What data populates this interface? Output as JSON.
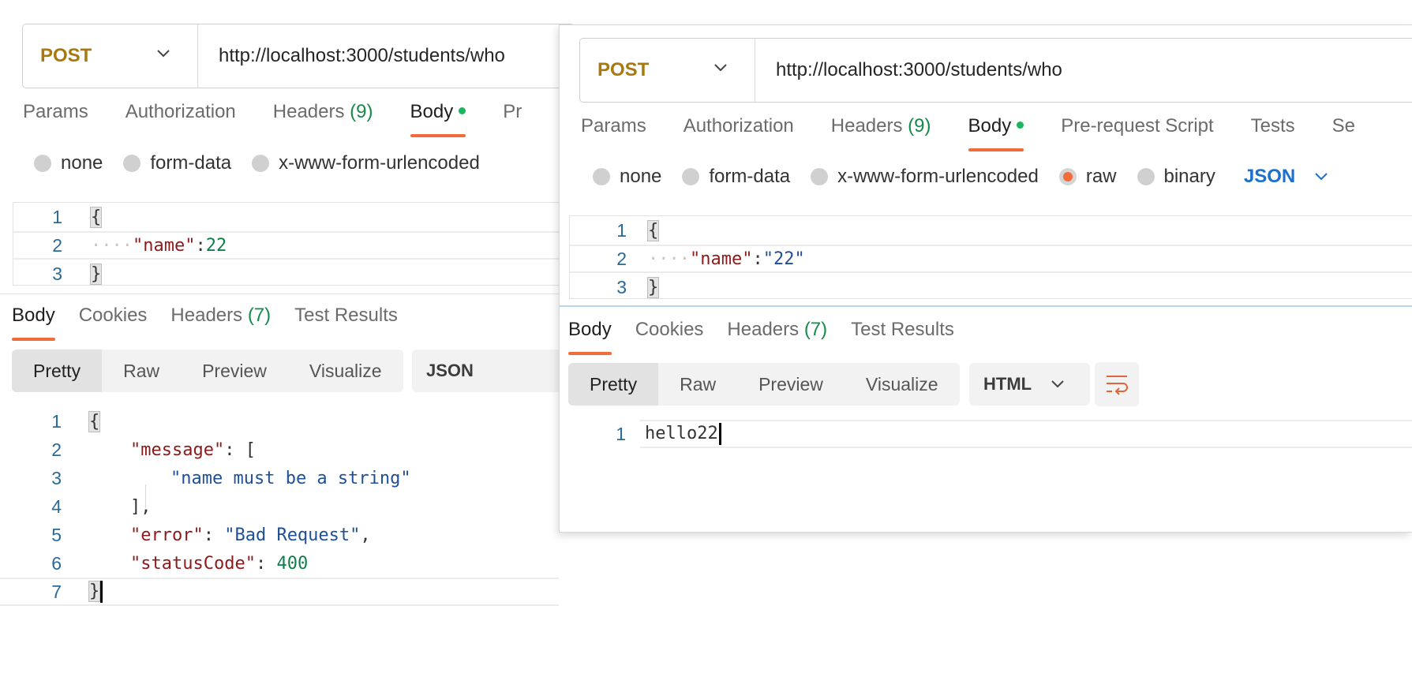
{
  "back": {
    "request": {
      "method": "POST",
      "url": "http://localhost:3000/students/who"
    },
    "tabs": [
      {
        "label": "Params"
      },
      {
        "label": "Authorization"
      },
      {
        "label": "Headers",
        "count": "(9)"
      },
      {
        "label": "Body"
      },
      {
        "label": "Pr"
      }
    ],
    "body_types": [
      "none",
      "form-data",
      "x-www-form-urlencoded"
    ],
    "request_body": {
      "lines": [
        "1",
        "2",
        "3"
      ],
      "open": "{",
      "ws": "····",
      "key": "\"name\"",
      "colon": ":",
      "value": "22",
      "close": "}"
    },
    "response_tabs": [
      {
        "label": "Body"
      },
      {
        "label": "Cookies"
      },
      {
        "label": "Headers",
        "count": "(7)"
      },
      {
        "label": "Test Results"
      }
    ],
    "view_modes": [
      "Pretty",
      "Raw",
      "Preview",
      "Visualize"
    ],
    "format": "JSON",
    "response": {
      "lines": [
        "1",
        "2",
        "3",
        "4",
        "5",
        "6",
        "7"
      ],
      "open": "{",
      "message_key": "\"message\"",
      "message_open": ": [",
      "message_item": "\"name must be a string\"",
      "message_close": "],",
      "error_key": "\"error\"",
      "error_sep": ": ",
      "error_value": "\"Bad Request\"",
      "error_comma": ",",
      "status_key": "\"statusCode\"",
      "status_sep": ": ",
      "status_value": "400",
      "close": "}"
    }
  },
  "front": {
    "request": {
      "method": "POST",
      "url": "http://localhost:3000/students/who"
    },
    "tabs": [
      {
        "label": "Params"
      },
      {
        "label": "Authorization"
      },
      {
        "label": "Headers",
        "count": "(9)"
      },
      {
        "label": "Body"
      },
      {
        "label": "Pre-request Script"
      },
      {
        "label": "Tests"
      },
      {
        "label": "Se"
      }
    ],
    "body_types": [
      "none",
      "form-data",
      "x-www-form-urlencoded",
      "raw",
      "binary"
    ],
    "selected_body_type": "raw",
    "body_language": "JSON",
    "request_body": {
      "lines": [
        "1",
        "2",
        "3"
      ],
      "open": "{",
      "ws": "····",
      "key": "\"name\"",
      "colon": ":",
      "value": "\"22\"",
      "close": "}"
    },
    "response_tabs": [
      {
        "label": "Body"
      },
      {
        "label": "Cookies"
      },
      {
        "label": "Headers",
        "count": "(7)"
      },
      {
        "label": "Test Results"
      }
    ],
    "view_modes": [
      "Pretty",
      "Raw",
      "Preview",
      "Visualize"
    ],
    "format": "HTML",
    "response": {
      "lines": [
        "1"
      ],
      "text": "hello22"
    }
  },
  "colors": {
    "accent": "#f26b3a",
    "method": "#a87a0e",
    "active_dot": "#1cb65e",
    "count": "#168a4a",
    "link": "#1a6fcf"
  }
}
